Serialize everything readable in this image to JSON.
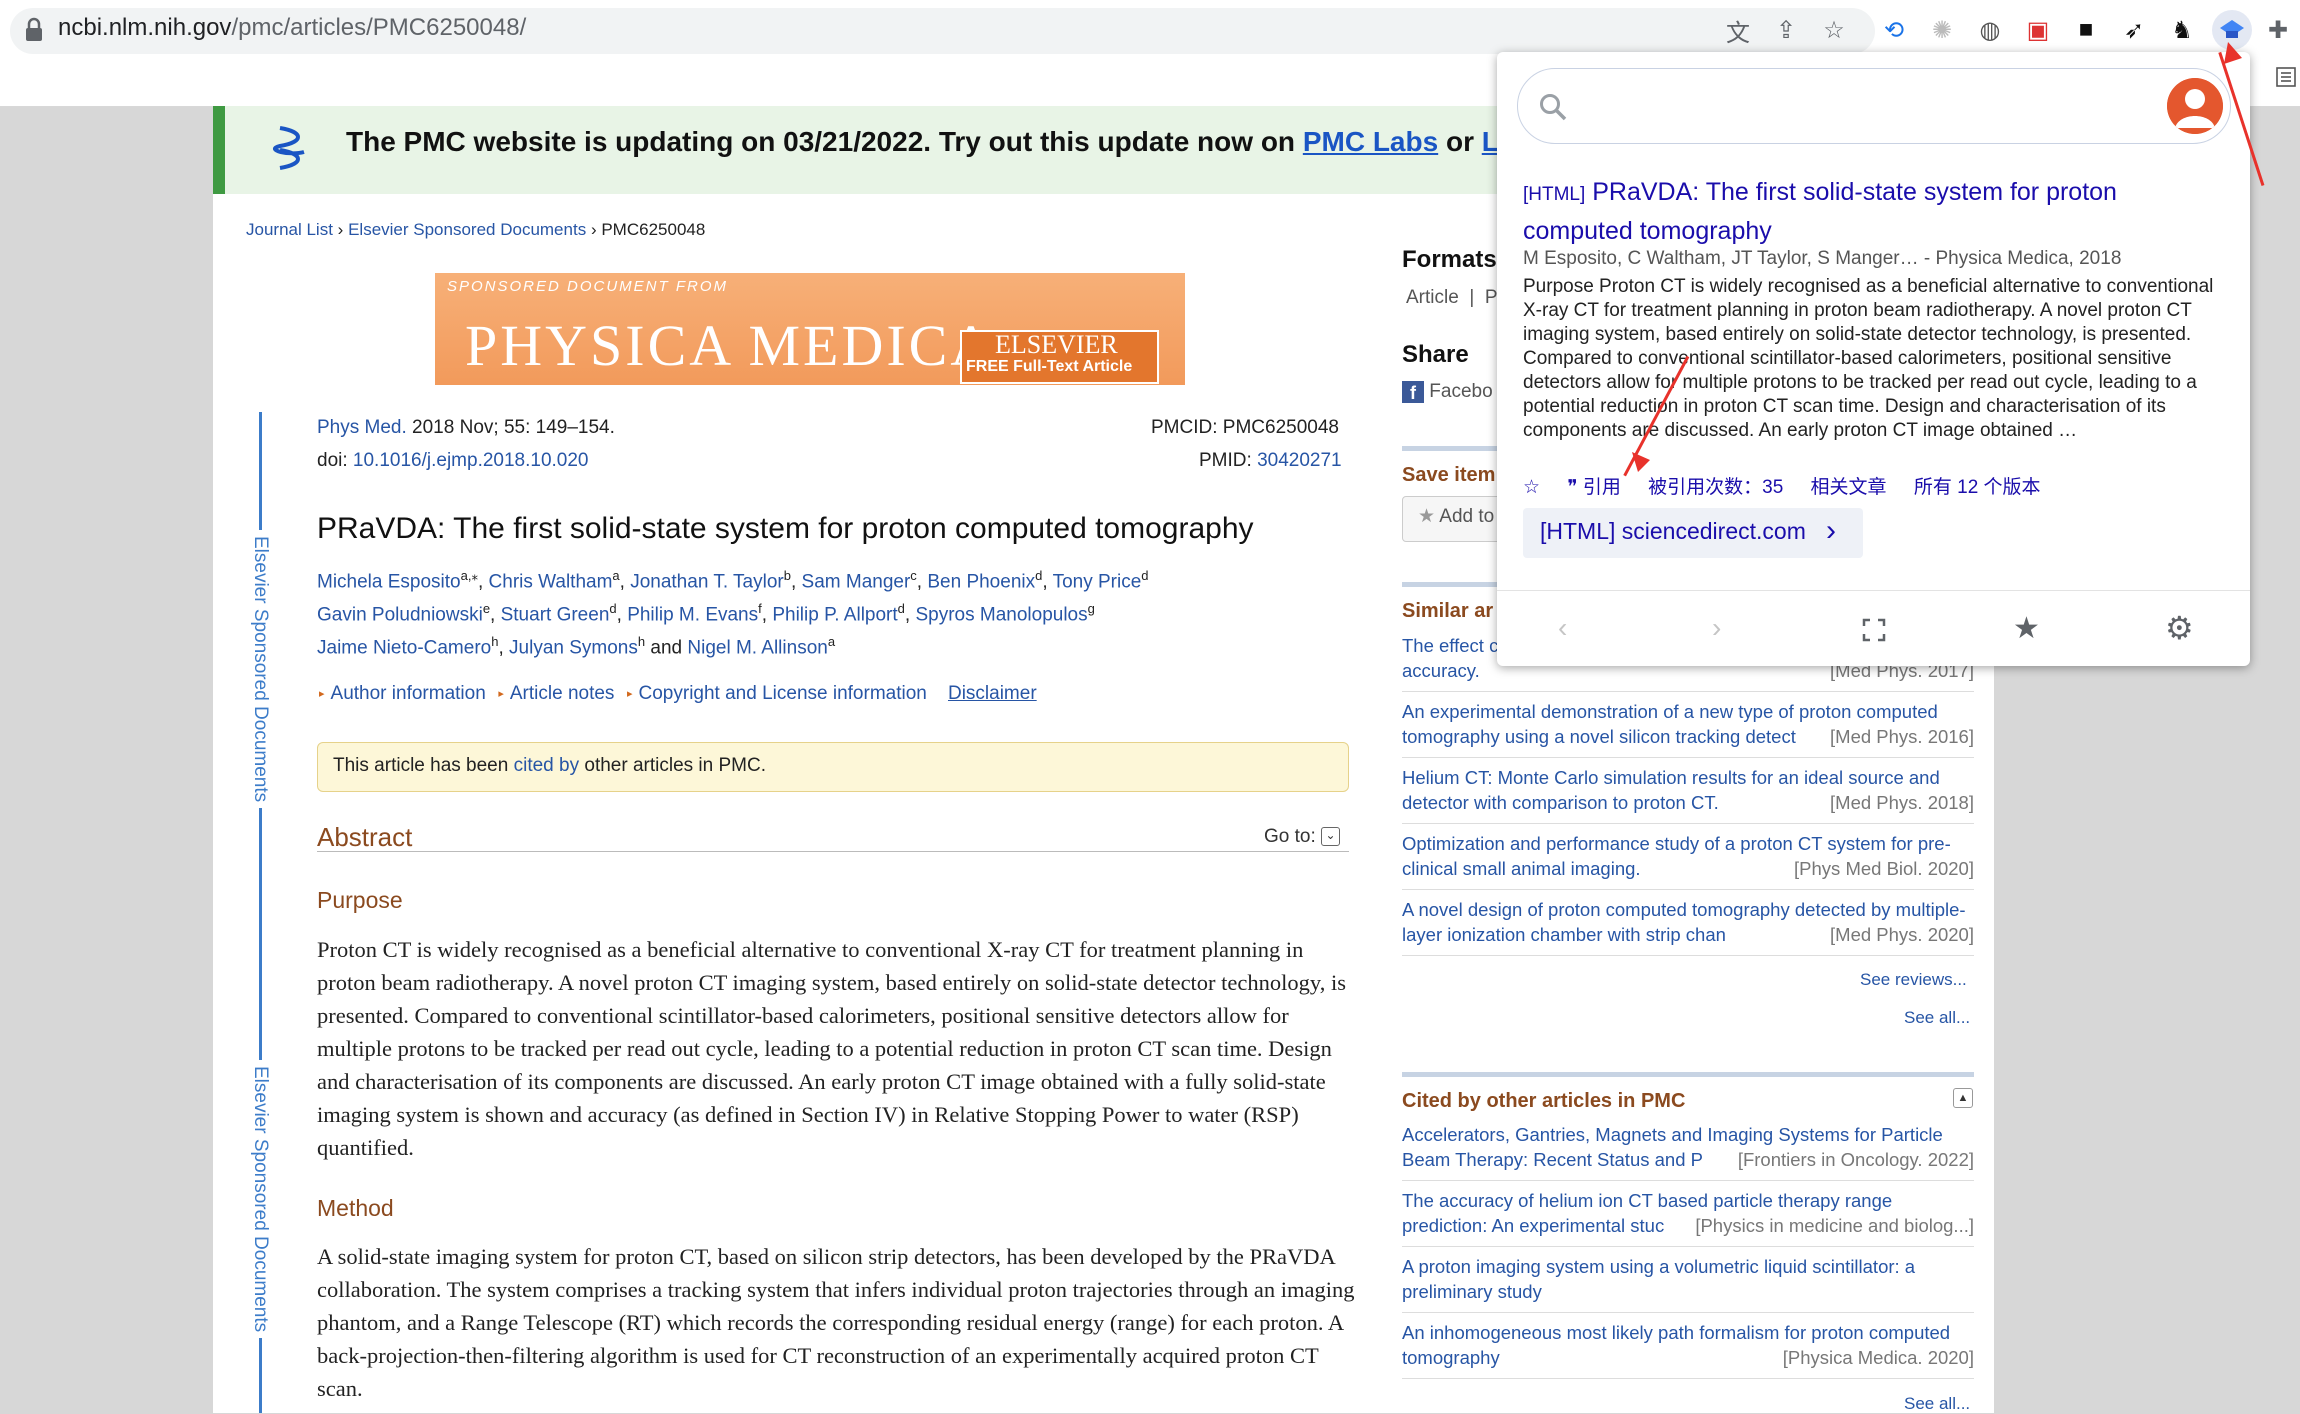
{
  "browser": {
    "url_host": "ncbi.nlm.nih.gov",
    "url_path": "/pmc/articles/PMC6250048/"
  },
  "banner": {
    "text_prefix": "The PMC website is updating on 03/21/2022. Try out this update now on",
    "link1": "PMC Labs",
    "text_mid": "or",
    "link2": "Lear"
  },
  "breadcrumb": {
    "item1": "Journal List",
    "sep": "›",
    "item2": "Elsevier Sponsored Documents",
    "item3": "PMC6250048"
  },
  "journal_logo": {
    "small": "SPONSORED DOCUMENT FROM",
    "big": "PHYSICA MEDICA",
    "publisher": "ELSEVIER",
    "free": "FREE Full-Text Article"
  },
  "side_label": "Elsevier Sponsored Documents",
  "citation": {
    "journal": "Phys Med.",
    "details": "2018 Nov; 55: 149–154.",
    "doi_label": "doi:",
    "doi": "10.1016/j.ejmp.2018.10.020",
    "pmcid": "PMCID: PMC6250048",
    "pmid_label": "PMID:",
    "pmid": "30420271"
  },
  "article": {
    "title": "PRaVDA: The first solid-state system for proton computed tomography",
    "authors_line1": [
      {
        "name": "Michela Esposito",
        "sup": "a,⁎"
      },
      {
        "name": "Chris Waltham",
        "sup": "a"
      },
      {
        "name": "Jonathan T. Taylor",
        "sup": "b"
      },
      {
        "name": "Sam Manger",
        "sup": "c"
      },
      {
        "name": "Ben Phoenix",
        "sup": "d"
      },
      {
        "name": "Tony Price",
        "sup": "d"
      }
    ],
    "authors_line2": [
      {
        "name": "Gavin Poludniowski",
        "sup": "e"
      },
      {
        "name": "Stuart Green",
        "sup": "d"
      },
      {
        "name": "Philip M. Evans",
        "sup": "f"
      },
      {
        "name": "Philip P. Allport",
        "sup": "d"
      },
      {
        "name": "Spyros Manolopulos",
        "sup": "g"
      }
    ],
    "authors_line3": [
      {
        "name": "Jaime Nieto-Camero",
        "sup": "h"
      },
      {
        "name": "Julyan Symons",
        "sup": "h"
      },
      {
        "name": "Nigel M. Allinson",
        "sup": "a"
      }
    ],
    "and_word": "and",
    "info_links": [
      "Author information",
      "Article notes",
      "Copyright and License information",
      "Disclaimer"
    ],
    "cited_prefix": "This article has been",
    "cited_link": "cited by",
    "cited_suffix": "other articles in PMC.",
    "abstract_heading": "Abstract",
    "goto": "Go to:",
    "purpose_heading": "Purpose",
    "purpose_text": "Proton CT is widely recognised as a beneficial alternative to conventional X-ray CT for treatment planning in proton beam radiotherapy. A novel proton CT imaging system, based entirely on solid-state detector technology, is presented. Compared to conventional scintillator-based calorimeters, positional sensitive detectors allow for multiple protons to be tracked per read out cycle, leading to a potential reduction in proton CT scan time. Design and characterisation of its components are discussed. An early proton CT image obtained with a fully solid-state imaging system is shown and accuracy (as defined in Section IV) in Relative Stopping Power to water (RSP) quantified.",
    "method_heading": "Method",
    "method_text": "A solid-state imaging system for proton CT, based on silicon strip detectors, has been developed by the PRaVDA collaboration. The system comprises a tracking system that infers individual proton trajectories through an imaging phantom, and a Range Telescope (RT) which records the corresponding residual energy (range) for each proton. A back-projection-then-filtering algorithm is used for CT reconstruction of an experimentally acquired proton CT scan."
  },
  "right_col": {
    "formats_heading": "Formats:",
    "formats_item": "Article",
    "formats_sep": "|",
    "formats_item2": "P",
    "share_heading": "Share",
    "share_facebook": "Facebo",
    "save_heading": "Save item",
    "save_button": "Add to",
    "similar_heading": "Similar ar",
    "similar_items": [
      {
        "text": "The effect c\naccuracy.",
        "src": "[Med Phys. 2017]"
      },
      {
        "text": "An experimental demonstration of a new type of proton computed tomography using a novel silicon tracking detect",
        "src": "[Med Phys. 2016]"
      },
      {
        "text": "Helium CT: Monte Carlo simulation results for an ideal source and detector with comparison to proton CT.",
        "src": "[Med Phys. 2018]"
      },
      {
        "text": "Optimization and performance study of a proton CT system for pre-clinical small animal imaging.",
        "src": "[Phys Med Biol. 2020]"
      },
      {
        "text": "A novel design of proton computed tomography detected by multiple-layer ionization chamber with strip chan",
        "src": "[Med Phys. 2020]"
      }
    ],
    "see_reviews": "See reviews...",
    "see_all_1": "See all...",
    "cited_heading": "Cited by other articles in PMC",
    "cited_items": [
      {
        "text": "Accelerators, Gantries, Magnets and Imaging Systems for Particle Beam Therapy: Recent Status and P",
        "src": "[Frontiers in Oncology. 2022]"
      },
      {
        "text": "The accuracy of helium ion CT based particle therapy range prediction: An experimental stuc",
        "src": "[Physics in medicine and biolog...]"
      },
      {
        "text": "A proton imaging system using a volumetric liquid scintillator: a preliminary study",
        "src": ""
      },
      {
        "text": "An inhomogeneous most likely path formalism for proton computed tomography",
        "src": "[Physica Medica. 2020]"
      }
    ],
    "see_all_2": "See all..."
  },
  "popup": {
    "search_placeholder": "",
    "result_tag": "[HTML]",
    "result_title": "PRaVDA: The first solid-state system for proton computed tomography",
    "result_authors": "M Esposito, C Waltham, JT Taylor, S Manger… - Physica Medica, 2018",
    "result_snippet": "Purpose Proton CT is widely recognised as a beneficial alternative to conventional X-ray CT for treatment planning in proton beam radiotherapy. A novel proton CT imaging system, based entirely on solid-state detector technology, is presented. Compared to conventional scintillator-based calorimeters, positional sensitive detectors allow for multiple protons to be tracked per read out cycle, leading to a potential reduction in proton CT scan time. Design and characterisation of its components are discussed. An early proton CT image obtained …",
    "actions": {
      "save_icon": "☆",
      "cite": "❞ 引用",
      "cited_by": "被引用次数：35",
      "related": "相关文章",
      "versions": "所有 12 个版本"
    },
    "link_text": "[HTML] sciencedirect.com",
    "footer_icons": [
      "prev-icon",
      "next-icon",
      "fullscreen-icon",
      "star-icon",
      "settings-icon"
    ]
  }
}
